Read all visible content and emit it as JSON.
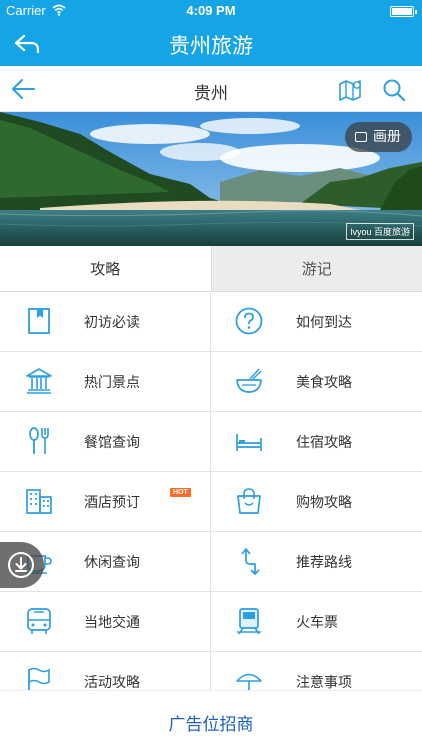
{
  "status_bar": {
    "carrier": "Carrier",
    "time": "4:09 PM"
  },
  "app_header": {
    "title": "贵州旅游"
  },
  "nav_bar": {
    "title": "贵州"
  },
  "banner": {
    "album_label": "画册",
    "watermark": "lvyou 百度旅游"
  },
  "tabs": [
    {
      "label": "攻略",
      "active": true
    },
    {
      "label": "游记",
      "active": false
    }
  ],
  "menu": [
    {
      "label": "初访必读",
      "icon": "bookmark-icon"
    },
    {
      "label": "如何到达",
      "icon": "question-circle-icon"
    },
    {
      "label": "热门景点",
      "icon": "landmark-icon"
    },
    {
      "label": "美食攻略",
      "icon": "noodle-bowl-icon"
    },
    {
      "label": "餐馆查询",
      "icon": "spoon-fork-icon"
    },
    {
      "label": "住宿攻略",
      "icon": "bed-icon"
    },
    {
      "label": "酒店预订",
      "icon": "buildings-icon",
      "badge": "HOT"
    },
    {
      "label": "购物攻略",
      "icon": "shopping-bag-icon"
    },
    {
      "label": "休闲查询",
      "icon": "coffee-cup-icon"
    },
    {
      "label": "推荐路线",
      "icon": "route-arrows-icon"
    },
    {
      "label": "当地交通",
      "icon": "bus-icon"
    },
    {
      "label": "火车票",
      "icon": "train-icon"
    },
    {
      "label": "活动攻略",
      "icon": "flag-icon"
    },
    {
      "label": "注意事项",
      "icon": "umbrella-icon"
    }
  ],
  "ad_bar": {
    "text": "广告位招商"
  },
  "colors": {
    "brand": "#15a4e6",
    "icon": "#2b9fe0",
    "hot_badge": "#ff6b2b",
    "ad_text": "#1a5fc2"
  }
}
